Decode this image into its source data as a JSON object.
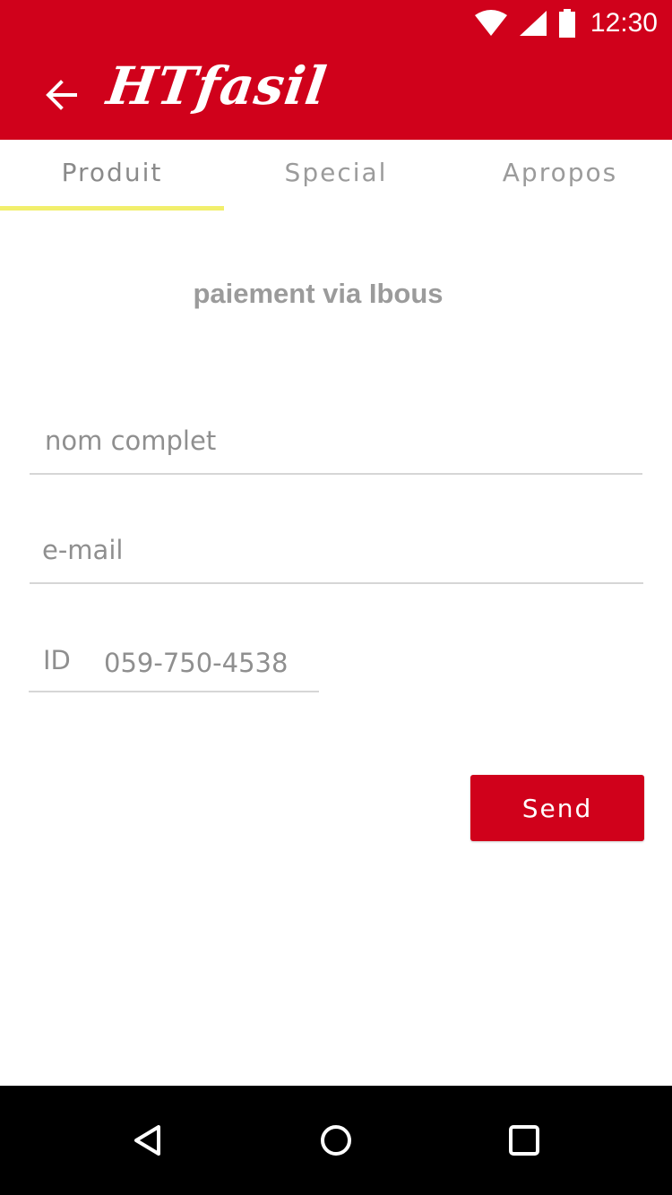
{
  "status_bar": {
    "time": "12:30",
    "icons": [
      "wifi-icon",
      "signal-icon",
      "battery-icon"
    ]
  },
  "app_bar": {
    "title": "HTfasil",
    "back_icon": "arrow-left-icon"
  },
  "tabs": [
    {
      "label": "Produit",
      "active": true
    },
    {
      "label": "Special",
      "active": false
    },
    {
      "label": "Apropos",
      "active": false
    }
  ],
  "form": {
    "heading": "paiement via Ibous",
    "name_placeholder": "nom complet",
    "email_placeholder": "e-mail",
    "id_prefix": "ID",
    "id_placeholder": "059-750-4538",
    "send_label": "Send"
  },
  "nav_bar": {
    "icons": [
      "back-triangle-icon",
      "home-circle-icon",
      "recents-square-icon"
    ]
  },
  "colors": {
    "brand_red": "#d0011b",
    "tab_indicator": "#f2ef6c",
    "text_gray": "#9b9b9b"
  }
}
